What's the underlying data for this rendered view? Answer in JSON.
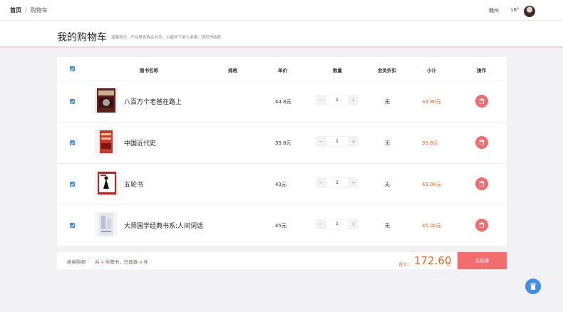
{
  "topbar": {
    "breadcrumb_home": "首页",
    "breadcrumb_sep": "/",
    "breadcrumb_current": "购物车",
    "city": "赣州",
    "temperature": "16°"
  },
  "page": {
    "title": "我的购物车",
    "tip": "温馨提示：产品是否购买成功，以最终下单为准哦，请尽快结算"
  },
  "table": {
    "headers": {
      "name": "图书名称",
      "spec": "规格",
      "price": "单价",
      "quantity": "数量",
      "discount": "会员折扣",
      "subtotal": "小计",
      "action": "操作"
    },
    "rows": [
      {
        "name": "八百万个老爸在路上",
        "price": "44.8元",
        "qty": "1",
        "discount": "无",
        "subtotal": "44.80元"
      },
      {
        "name": "中国近代史",
        "price": "39.8元",
        "qty": "1",
        "discount": "无",
        "subtotal": "39.8元"
      },
      {
        "name": "五轮书",
        "price": "43元",
        "qty": "1",
        "discount": "无",
        "subtotal": "43.00元"
      },
      {
        "name": "大师国学经典书系:人间词话",
        "price": "45元",
        "qty": "1",
        "discount": "无",
        "subtotal": "45.00元"
      }
    ],
    "minus": "−",
    "plus": "+"
  },
  "footer": {
    "continue": "继续购物",
    "sep": "|",
    "summary_pre": "共",
    "book_count": "4",
    "summary_mid": "件图书，已选择",
    "selected_count": "4",
    "summary_post": "件",
    "total_label": "合计:",
    "total_value": "172.60",
    "total_unit": "元",
    "checkout": "去结算"
  },
  "colors": {
    "accent_orange": "#e06b2a",
    "danger_red": "#f26d6d",
    "primary_blue": "#3d8fe8",
    "checkbox_blue": "#4a90e2"
  },
  "icons": {
    "delete": "trash-icon",
    "checkbox": "check-icon"
  }
}
